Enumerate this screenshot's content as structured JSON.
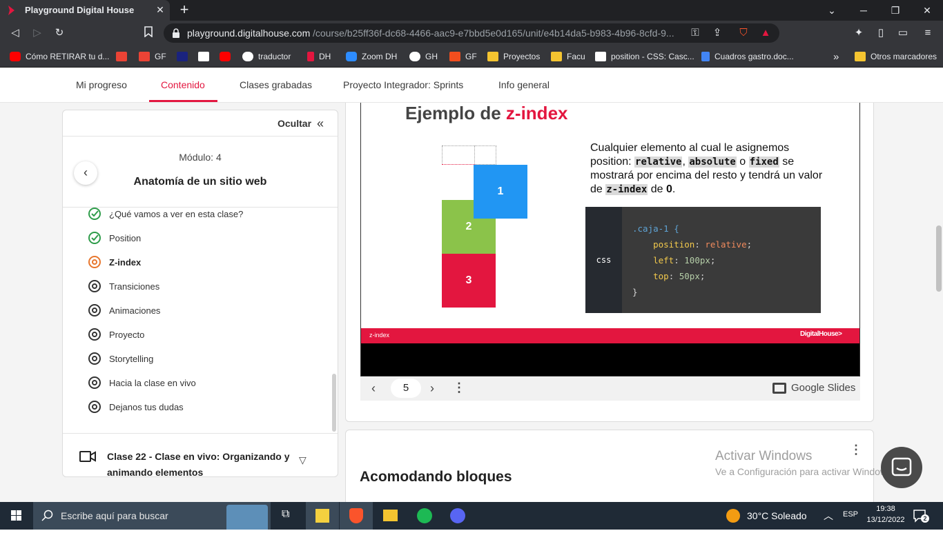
{
  "browser": {
    "tab_title": "Playground Digital House",
    "url_host": "playground.digitalhouse.com",
    "url_path": "/course/b25ff36f-dc68-4466-aac9-e7bbd5e0d165/unit/e4b14da5-b983-4b96-8cfd-9...",
    "bookmarks": [
      {
        "label": "Cómo RETIRAR tu d...",
        "icon": "youtube-icon",
        "color": "#ff0000"
      },
      {
        "label": "",
        "icon": "gmail-icon",
        "color": "#ea4335"
      },
      {
        "label": "GF",
        "icon": "gmail-icon",
        "color": "#ea4335"
      },
      {
        "label": "",
        "icon": "site-icon",
        "color": "#1a237e"
      },
      {
        "label": "",
        "icon": "uec-icon",
        "color": "#ffffff"
      },
      {
        "label": "",
        "icon": "youtube-icon",
        "color": "#ff0000"
      },
      {
        "label": "traductor",
        "icon": "google-icon",
        "color": "#ffffff"
      },
      {
        "label": "DH",
        "icon": "dh-icon",
        "color": "#e3163f"
      },
      {
        "label": "Zoom DH",
        "icon": "zoom-icon",
        "color": "#2d8cff"
      },
      {
        "label": "GH",
        "icon": "github-icon",
        "color": "#ffffff"
      },
      {
        "label": "GF",
        "icon": "figma-icon",
        "color": "#f24e1e"
      },
      {
        "label": "Proyectos",
        "icon": "folder-icon",
        "color": "#f4c430"
      },
      {
        "label": "Facu",
        "icon": "folder-icon",
        "color": "#f4c430"
      },
      {
        "label": "position - CSS: Casc...",
        "icon": "mdn-icon",
        "color": "#ffffff"
      },
      {
        "label": "Cuadros gastro.doc...",
        "icon": "docs-icon",
        "color": "#4285f4"
      }
    ],
    "more_bookmarks": "»",
    "other_bookmarks": "Otros marcadores"
  },
  "nav": {
    "items": [
      "Mi progreso",
      "Contenido",
      "Clases grabadas",
      "Proyecto Integrador: Sprints",
      "Info general"
    ],
    "active": "Contenido"
  },
  "sidebar": {
    "hide_label": "Ocultar",
    "module_number": "Módulo:  4",
    "module_title": "Anatomía de un sitio web",
    "lessons": [
      {
        "label": "¿Qué vamos a ver en esta clase?",
        "status": "done"
      },
      {
        "label": "Position",
        "status": "done"
      },
      {
        "label": "Z-index",
        "status": "current"
      },
      {
        "label": "Transiciones",
        "status": "pending"
      },
      {
        "label": "Animaciones",
        "status": "pending"
      },
      {
        "label": "Proyecto",
        "status": "pending"
      },
      {
        "label": "Storytelling",
        "status": "pending"
      },
      {
        "label": "Hacia la clase en vivo",
        "status": "pending"
      },
      {
        "label": "Dejanos tus dudas",
        "status": "pending"
      }
    ],
    "next_class": "Clase 22 - Clase en vivo: Organizando y animando elementos"
  },
  "slide": {
    "title_prefix": "Ejemplo de ",
    "title_highlight": "z-index",
    "boxes": [
      {
        "label": "1",
        "color": "#2196f3"
      },
      {
        "label": "2",
        "color": "#8bc34a"
      },
      {
        "label": "3",
        "color": "#e3163f"
      }
    ],
    "text_1": "Cualquier elemento al cual le asignemos position: ",
    "kw_relative": "relative",
    "sep_1": ", ",
    "kw_absolute": "absolute",
    "sep_2": " o ",
    "kw_fixed": "fixed",
    "text_2": " se mostrará por encima del resto y tendrá un valor de ",
    "kw_zindex": "z-index",
    "text_3": " de ",
    "zero": "0",
    "text_4": ".",
    "code_label": "css",
    "code": {
      "selector": ".caja-1 {",
      "l1_prop": "position",
      "l1_val": "relative",
      "l2_prop": "left",
      "l2_val": "100px",
      "l3_prop": "top",
      "l3_val": "50px",
      "close": "}"
    },
    "footer_label": "z-index",
    "footer_brand": "DigitalHouse>"
  },
  "slides_bar": {
    "page": "5",
    "brand": "Google Slides"
  },
  "second_card": {
    "title": "Acomodando bloques"
  },
  "watermark": {
    "line1": "Activar Windows",
    "line2": "Ve a Configuración para activar Windows."
  },
  "taskbar": {
    "search_placeholder": "Escribe aquí para buscar",
    "weather": "30°C  Soleado",
    "lang": "ESP",
    "time": "19:38",
    "date": "13/12/2022",
    "notifications": "2"
  },
  "colors": {
    "accent": "#e3163f",
    "done": "#2e9c4a",
    "current": "#e8772e"
  }
}
